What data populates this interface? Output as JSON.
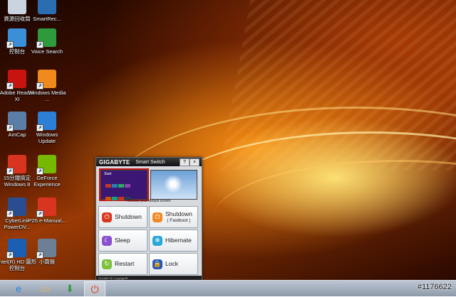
{
  "desktop": {
    "icons": [
      {
        "label": "資源回收筒",
        "icon": "recycle-bin-icon",
        "color": "#c9d4e0"
      },
      {
        "label": "SmartRec...",
        "icon": "smart-recovery-icon",
        "color": "#2a6db0"
      },
      {
        "label": "控制台",
        "icon": "control-panel-icon",
        "color": "#3a8fd8"
      },
      {
        "label": "Voice Search",
        "icon": "microphone-icon",
        "color": "#2f9a3b"
      },
      {
        "label": "Adobe Reader XI",
        "icon": "adobe-reader-icon",
        "color": "#c8140f"
      },
      {
        "label": "Windows Media ...",
        "icon": "media-player-icon",
        "color": "#f08a1c"
      },
      {
        "label": "AmCap",
        "icon": "camera-icon",
        "color": "#5a7ea8"
      },
      {
        "label": "Windows Update",
        "icon": "windows-update-icon",
        "color": "#2d7fd6"
      },
      {
        "label": "15分鐘搞定 Windows 8",
        "icon": "pdf-document-icon",
        "color": "#d9341f"
      },
      {
        "label": "GeForce Experience",
        "icon": "geforce-icon",
        "color": "#76b900"
      },
      {
        "label": "CyberLink PowerDV...",
        "icon": "powerdvd-icon",
        "color": "#2a4d8f"
      },
      {
        "label": "P25 e-Manual...",
        "icon": "pdf-document-icon",
        "color": "#d9341f"
      },
      {
        "label": "Intel(R) HD 圖形控制台",
        "icon": "intel-graphics-icon",
        "color": "#1a5fb4"
      },
      {
        "label": "小算盤",
        "icon": "calculator-icon",
        "color": "#6d7f94"
      }
    ]
  },
  "smart_switch": {
    "brand": "GIGABYTE",
    "title": "Smart Switch",
    "help": "?",
    "close": "×",
    "start_label": "Start",
    "caption": "Choose your default screen",
    "footer": "GIGABYTE Copyright®",
    "buttons": [
      {
        "label": "Shutdown",
        "sub": "",
        "icon": "power-icon",
        "color": "#d9381e"
      },
      {
        "label": "Shutdown",
        "sub": "( Fastboot )",
        "icon": "fast-power-icon",
        "color": "#f08a24"
      },
      {
        "label": "Sleep",
        "sub": "",
        "icon": "moon-icon",
        "color": "#8a4fd0"
      },
      {
        "label": "Hibernate",
        "sub": "",
        "icon": "hibernate-icon",
        "color": "#2aa7d8"
      },
      {
        "label": "Restart",
        "sub": "",
        "icon": "restart-icon",
        "color": "#7cc13a"
      },
      {
        "label": "Lock",
        "sub": "",
        "icon": "lock-icon",
        "color": "#2c57b8"
      }
    ]
  },
  "taskbar": {
    "items": [
      {
        "icon": "internet-explorer-icon",
        "glyph": "e",
        "color": "#1e88e5"
      },
      {
        "icon": "file-explorer-icon",
        "glyph": "▭",
        "color": "#e0b84a"
      },
      {
        "icon": "download-icon",
        "glyph": "⬇",
        "color": "#2e9b3a"
      },
      {
        "icon": "smart-switch-taskbar-icon",
        "glyph": "⏻",
        "color": "#d9381e"
      }
    ]
  },
  "watermark": "#1176622"
}
